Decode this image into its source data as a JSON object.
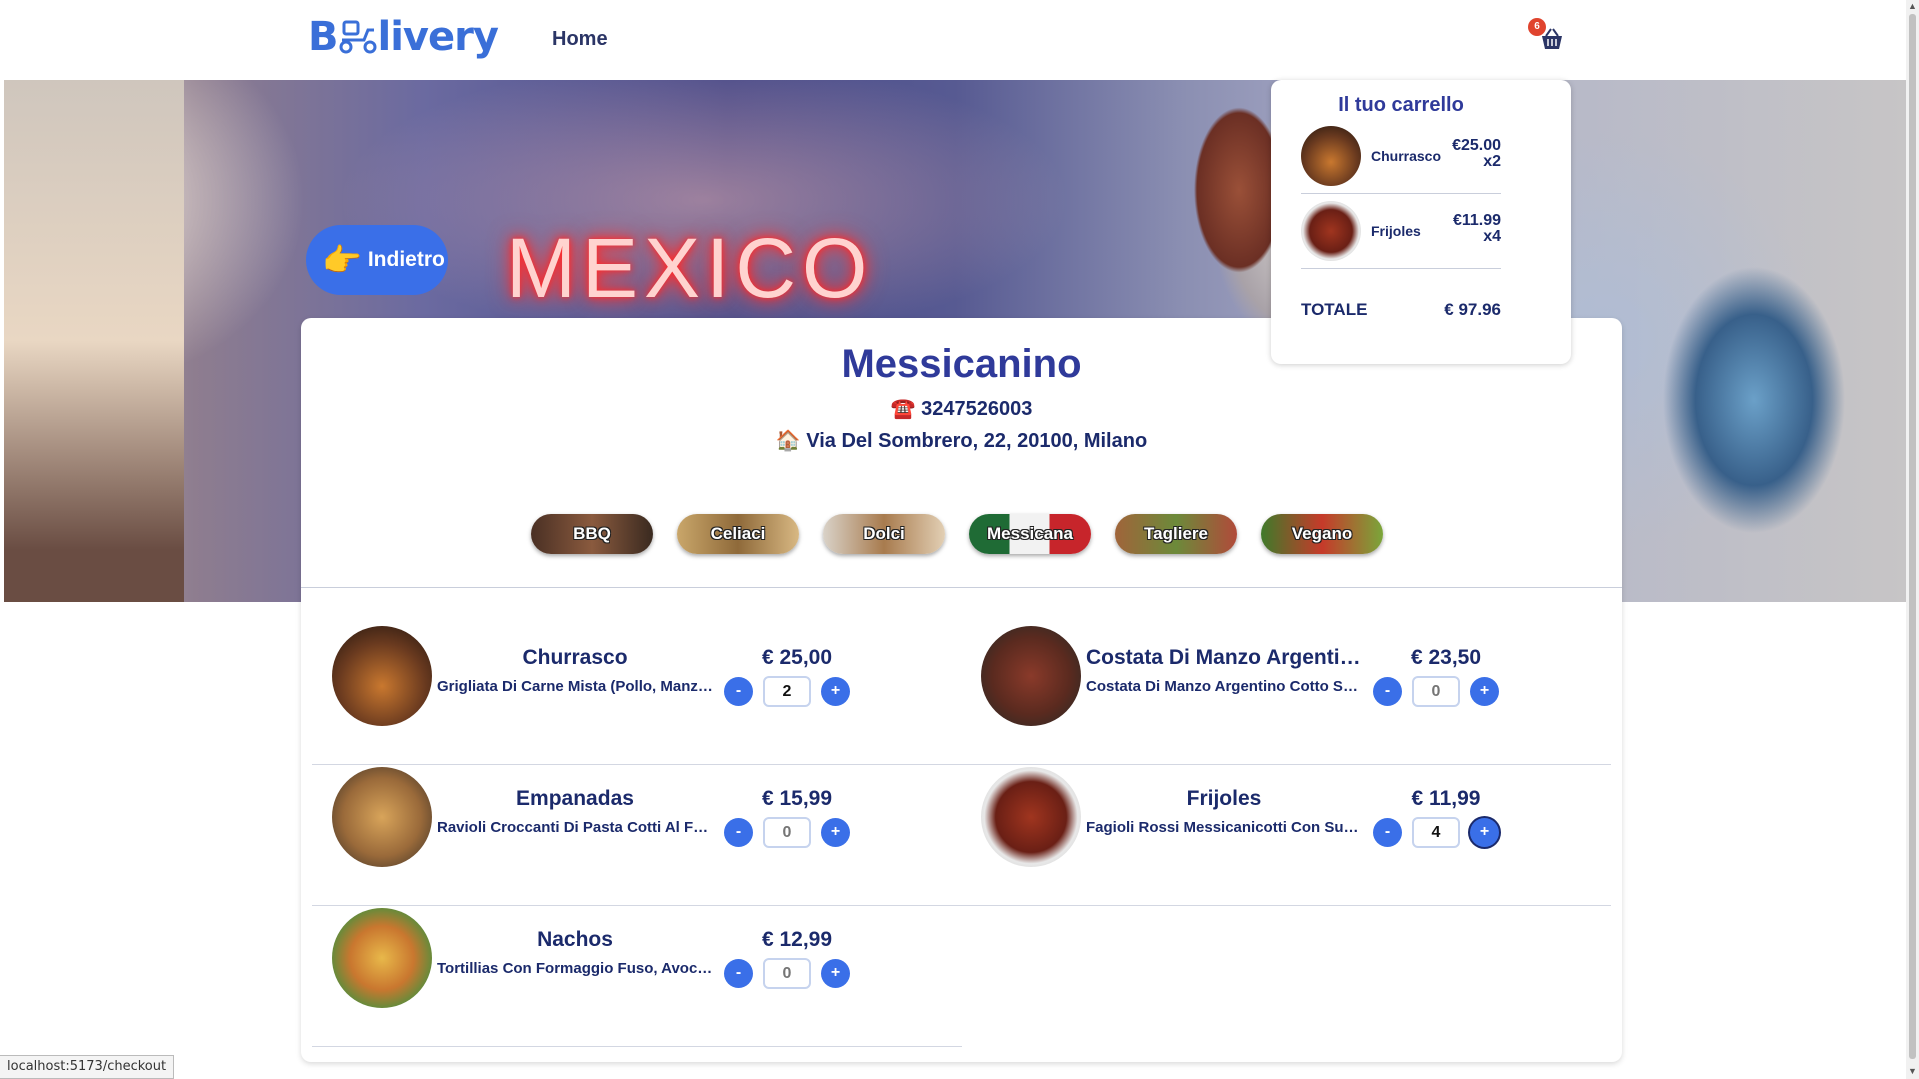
{
  "header": {
    "logo": "Bdelivery",
    "nav_home": "Home",
    "cart_count": "6"
  },
  "hero": {
    "neon_text": "MEXICO",
    "back_label": "Indietro"
  },
  "restaurant": {
    "name": "Messicanino",
    "phone": "☎️ 3247526003",
    "address": "🏠 Via Del Sombrero, 22, 20100, Milano"
  },
  "categories": [
    {
      "label": "BBQ",
      "color": "#6b4a3a"
    },
    {
      "label": "Celiaci",
      "color": "#b48a4a"
    },
    {
      "label": "Dolci",
      "color": "#c9a37a"
    },
    {
      "label": "Messicana",
      "color": "#2f7a3c"
    },
    {
      "label": "Tagliere",
      "color": "#8a6a4a"
    },
    {
      "label": "Vegano",
      "color": "#5f8a3a"
    }
  ],
  "menu": [
    {
      "name": "Churrasco",
      "desc": "Grigliata Di Carne Mista (Pollo, Manzo, M...",
      "price": "€ 25,00",
      "qty": "2",
      "minus": "-",
      "plus": "+"
    },
    {
      "name": "Costata Di Manzo Argentino Alla...",
      "desc": "Costata Di Manzo Argentino Cotto Su Bra...",
      "price": "€ 23,50",
      "qty": "0",
      "minus": "-",
      "plus": "+"
    },
    {
      "name": "Empanadas",
      "desc": "Ravioli Croccanti Di Pasta Cotti Al Forno ...",
      "price": "€ 15,99",
      "qty": "0",
      "minus": "-",
      "plus": "+"
    },
    {
      "name": "Frijoles",
      "desc": "Fagioli Rossi Messicanicotti Con Sugo Pi...",
      "price": "€ 11,99",
      "qty": "4",
      "minus": "-",
      "plus": "+"
    },
    {
      "name": "Nachos",
      "desc": "Tortillias Con Formaggio Fuso, Avocado E...",
      "price": "€ 12,99",
      "qty": "0",
      "minus": "-",
      "plus": "+"
    }
  ],
  "cart": {
    "title": "Il tuo carrello",
    "items": [
      {
        "name": "Churrasco",
        "price": "€25.00",
        "qty": "x2"
      },
      {
        "name": "Frijoles",
        "price": "€11.99",
        "qty": "x4"
      }
    ],
    "total_label": "TOTALE",
    "total_value": "€ 97.96"
  },
  "status_url": "localhost:5173/checkout",
  "colors": {
    "accent": "#3a6fe8",
    "text": "#1b2a6b",
    "title": "#2f3a9a",
    "badge": "#e0442e"
  }
}
